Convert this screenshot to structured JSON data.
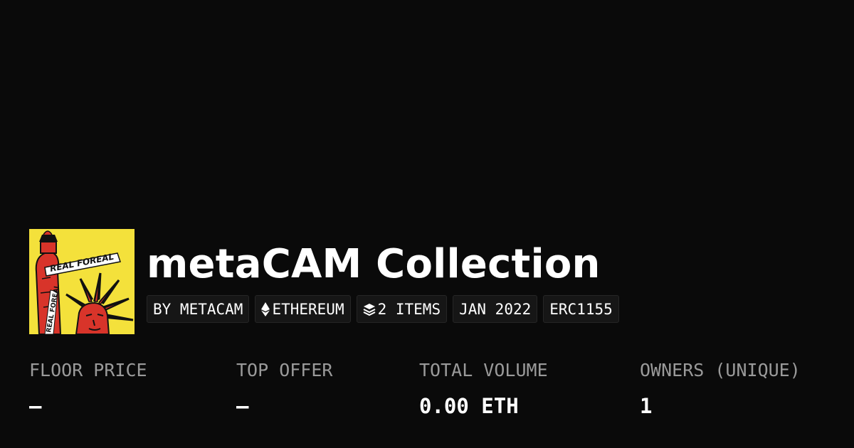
{
  "collection": {
    "name": "metaCAM Collection",
    "logo": {
      "text_top": "REAL FOREAL",
      "text_side": "REAL FOREAL",
      "colors": {
        "background": "#f4e13b",
        "figure": "#d8342a",
        "outline": "#111111"
      }
    },
    "tags": [
      {
        "label": "BY METACAM",
        "icon": null
      },
      {
        "label": "ETHEREUM",
        "icon": "ethereum-icon"
      },
      {
        "label": "2 ITEMS",
        "icon": "layers-icon"
      },
      {
        "label": "JAN 2022",
        "icon": null
      },
      {
        "label": "ERC1155",
        "icon": null
      }
    ]
  },
  "stats": [
    {
      "label": "FLOOR PRICE",
      "value": "–"
    },
    {
      "label": "TOP OFFER",
      "value": "–"
    },
    {
      "label": "TOTAL VOLUME",
      "value": "0.00 ETH"
    },
    {
      "label": "OWNERS (UNIQUE)",
      "value": "1"
    }
  ],
  "colors": {
    "background": "#0a0a0a",
    "tag_background": "#161616",
    "label_gray": "#9a9a9a",
    "text": "#ffffff"
  }
}
